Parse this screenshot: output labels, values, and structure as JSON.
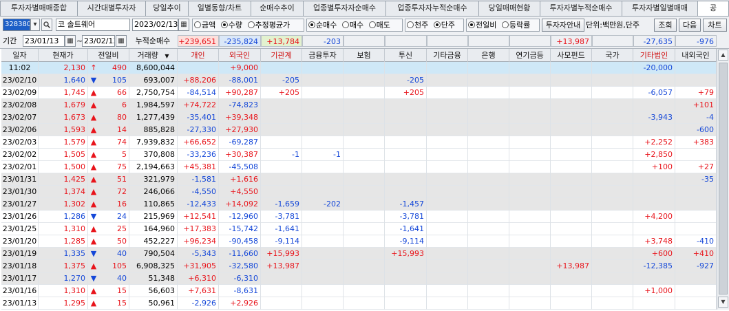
{
  "tabs": [
    {
      "label": "투자자별매매종합",
      "active": false
    },
    {
      "label": "시간대별투자자",
      "active": false
    },
    {
      "label": "당일추이",
      "active": false
    },
    {
      "label": "일별동향/차트",
      "active": false
    },
    {
      "label": "순매수추이",
      "active": false
    },
    {
      "label": "업종별투자자순매수",
      "active": false
    },
    {
      "label": "업종투자자누적순매수",
      "active": false
    },
    {
      "label": "당일매매현황",
      "active": false
    },
    {
      "label": "투자자별누적순매수",
      "active": false
    },
    {
      "label": "투자자별일별매매",
      "active": false
    },
    {
      "label": "공",
      "active": true
    }
  ],
  "toolbar": {
    "stock_code": "328380",
    "market_label": "코",
    "stock_name": "솔트웨어",
    "base_date": "2023/02/13",
    "radios1": [
      {
        "label": "금액",
        "on": false
      },
      {
        "label": "수량",
        "on": true
      },
      {
        "label": "추정평균가",
        "on": false
      }
    ],
    "radios2": [
      {
        "label": "순매수",
        "on": true
      },
      {
        "label": "매수",
        "on": false
      },
      {
        "label": "매도",
        "on": false
      }
    ],
    "radios3": [
      {
        "label": "천주",
        "on": false
      },
      {
        "label": "단주",
        "on": true
      }
    ],
    "radios4": [
      {
        "label": "전일비",
        "on": true
      },
      {
        "label": "등락률",
        "on": false
      }
    ],
    "guide_button": "투자자안내",
    "unit_text": "단위:백만원,단주",
    "search_button": "조회",
    "next_button": "다음",
    "chart_button": "차트"
  },
  "period": {
    "label": "기간",
    "start": "23/01/13",
    "tilde": "~",
    "end": "23/02/13",
    "cumulative_label": "누적순매수"
  },
  "summary": {
    "individual": "+239,651",
    "foreign": "-235,824",
    "institution": "+13,784",
    "financial": "-203",
    "insurance": "",
    "trust": "",
    "other_finance": "",
    "bank": "",
    "pension": "",
    "private_fund": "+13,987",
    "nation": "",
    "other_corp": "-27,635",
    "domestic_foreign": "-976"
  },
  "columns": [
    "일자",
    "현재가",
    "전일비",
    "거래량",
    "개인",
    "외국인",
    "기관계",
    "금융투자",
    "보험",
    "투신",
    "기타금융",
    "은행",
    "연기금등",
    "사모펀드",
    "국가",
    "기타법인",
    "내외국인"
  ],
  "sort_icon": "▼",
  "rows": [
    {
      "date": "11:02",
      "price": "2,130",
      "dir": "up-strong",
      "chg": "490",
      "vol": "8,600,044",
      "ind": "",
      "frn": "+9,000",
      "inst": "",
      "fin": "",
      "ins": "",
      "trust": "",
      "oth": "",
      "bank": "",
      "pen": "",
      "pf": "",
      "nat": "",
      "corp": "-20,000",
      "dom": ""
    },
    {
      "date": "23/02/10",
      "price": "1,640",
      "dir": "down",
      "chg": "105",
      "vol": "693,007",
      "ind": "+88,206",
      "frn": "-88,001",
      "inst": "-205",
      "fin": "",
      "ins": "",
      "trust": "-205",
      "oth": "",
      "bank": "",
      "pen": "",
      "pf": "",
      "nat": "",
      "corp": "",
      "dom": ""
    },
    {
      "date": "23/02/09",
      "price": "1,745",
      "dir": "up",
      "chg": "66",
      "vol": "2,750,754",
      "ind": "-84,514",
      "frn": "+90,287",
      "inst": "+205",
      "fin": "",
      "ins": "",
      "trust": "+205",
      "oth": "",
      "bank": "",
      "pen": "",
      "pf": "",
      "nat": "",
      "corp": "-6,057",
      "dom": "+79"
    },
    {
      "date": "23/02/08",
      "price": "1,679",
      "dir": "up",
      "chg": "6",
      "vol": "1,984,597",
      "ind": "+74,722",
      "frn": "-74,823",
      "inst": "",
      "fin": "",
      "ins": "",
      "trust": "",
      "oth": "",
      "bank": "",
      "pen": "",
      "pf": "",
      "nat": "",
      "corp": "",
      "dom": "+101"
    },
    {
      "date": "23/02/07",
      "price": "1,673",
      "dir": "up",
      "chg": "80",
      "vol": "1,277,439",
      "ind": "-35,401",
      "frn": "+39,348",
      "inst": "",
      "fin": "",
      "ins": "",
      "trust": "",
      "oth": "",
      "bank": "",
      "pen": "",
      "pf": "",
      "nat": "",
      "corp": "-3,943",
      "dom": "-4"
    },
    {
      "date": "23/02/06",
      "price": "1,593",
      "dir": "up",
      "chg": "14",
      "vol": "885,828",
      "ind": "-27,330",
      "frn": "+27,930",
      "inst": "",
      "fin": "",
      "ins": "",
      "trust": "",
      "oth": "",
      "bank": "",
      "pen": "",
      "pf": "",
      "nat": "",
      "corp": "",
      "dom": "-600"
    },
    {
      "date": "23/02/03",
      "price": "1,579",
      "dir": "up",
      "chg": "74",
      "vol": "7,939,832",
      "ind": "+66,652",
      "frn": "-69,287",
      "inst": "",
      "fin": "",
      "ins": "",
      "trust": "",
      "oth": "",
      "bank": "",
      "pen": "",
      "pf": "",
      "nat": "",
      "corp": "+2,252",
      "dom": "+383"
    },
    {
      "date": "23/02/02",
      "price": "1,505",
      "dir": "up",
      "chg": "5",
      "vol": "370,808",
      "ind": "-33,236",
      "frn": "+30,387",
      "inst": "-1",
      "fin": "-1",
      "ins": "",
      "trust": "",
      "oth": "",
      "bank": "",
      "pen": "",
      "pf": "",
      "nat": "",
      "corp": "+2,850",
      "dom": ""
    },
    {
      "date": "23/02/01",
      "price": "1,500",
      "dir": "up",
      "chg": "75",
      "vol": "2,194,663",
      "ind": "+45,381",
      "frn": "-45,508",
      "inst": "",
      "fin": "",
      "ins": "",
      "trust": "",
      "oth": "",
      "bank": "",
      "pen": "",
      "pf": "",
      "nat": "",
      "corp": "+100",
      "dom": "+27"
    },
    {
      "date": "23/01/31",
      "price": "1,425",
      "dir": "up",
      "chg": "51",
      "vol": "321,979",
      "ind": "-1,581",
      "frn": "+1,616",
      "inst": "",
      "fin": "",
      "ins": "",
      "trust": "",
      "oth": "",
      "bank": "",
      "pen": "",
      "pf": "",
      "nat": "",
      "corp": "",
      "dom": "-35"
    },
    {
      "date": "23/01/30",
      "price": "1,374",
      "dir": "up",
      "chg": "72",
      "vol": "246,066",
      "ind": "-4,550",
      "frn": "+4,550",
      "inst": "",
      "fin": "",
      "ins": "",
      "trust": "",
      "oth": "",
      "bank": "",
      "pen": "",
      "pf": "",
      "nat": "",
      "corp": "",
      "dom": ""
    },
    {
      "date": "23/01/27",
      "price": "1,302",
      "dir": "up",
      "chg": "16",
      "vol": "110,865",
      "ind": "-12,433",
      "frn": "+14,092",
      "inst": "-1,659",
      "fin": "-202",
      "ins": "",
      "trust": "-1,457",
      "oth": "",
      "bank": "",
      "pen": "",
      "pf": "",
      "nat": "",
      "corp": "",
      "dom": ""
    },
    {
      "date": "23/01/26",
      "price": "1,286",
      "dir": "down",
      "chg": "24",
      "vol": "215,969",
      "ind": "+12,541",
      "frn": "-12,960",
      "inst": "-3,781",
      "fin": "",
      "ins": "",
      "trust": "-3,781",
      "oth": "",
      "bank": "",
      "pen": "",
      "pf": "",
      "nat": "",
      "corp": "+4,200",
      "dom": ""
    },
    {
      "date": "23/01/25",
      "price": "1,310",
      "dir": "up",
      "chg": "25",
      "vol": "164,960",
      "ind": "+17,383",
      "frn": "-15,742",
      "inst": "-1,641",
      "fin": "",
      "ins": "",
      "trust": "-1,641",
      "oth": "",
      "bank": "",
      "pen": "",
      "pf": "",
      "nat": "",
      "corp": "",
      "dom": ""
    },
    {
      "date": "23/01/20",
      "price": "1,285",
      "dir": "up",
      "chg": "50",
      "vol": "452,227",
      "ind": "+96,234",
      "frn": "-90,458",
      "inst": "-9,114",
      "fin": "",
      "ins": "",
      "trust": "-9,114",
      "oth": "",
      "bank": "",
      "pen": "",
      "pf": "",
      "nat": "",
      "corp": "+3,748",
      "dom": "-410"
    },
    {
      "date": "23/01/19",
      "price": "1,335",
      "dir": "down",
      "chg": "40",
      "vol": "790,504",
      "ind": "-5,343",
      "frn": "-11,660",
      "inst": "+15,993",
      "fin": "",
      "ins": "",
      "trust": "+15,993",
      "oth": "",
      "bank": "",
      "pen": "",
      "pf": "",
      "nat": "",
      "corp": "+600",
      "dom": "+410"
    },
    {
      "date": "23/01/18",
      "price": "1,375",
      "dir": "up",
      "chg": "105",
      "vol": "6,908,325",
      "ind": "+31,905",
      "frn": "-32,580",
      "inst": "+13,987",
      "fin": "",
      "ins": "",
      "trust": "",
      "oth": "",
      "bank": "",
      "pen": "",
      "pf": "+13,987",
      "nat": "",
      "corp": "-12,385",
      "dom": "-927"
    },
    {
      "date": "23/01/17",
      "price": "1,270",
      "dir": "down",
      "chg": "40",
      "vol": "51,348",
      "ind": "+6,310",
      "frn": "-6,310",
      "inst": "",
      "fin": "",
      "ins": "",
      "trust": "",
      "oth": "",
      "bank": "",
      "pen": "",
      "pf": "",
      "nat": "",
      "corp": "",
      "dom": ""
    },
    {
      "date": "23/01/16",
      "price": "1,310",
      "dir": "up",
      "chg": "15",
      "vol": "56,603",
      "ind": "+7,631",
      "frn": "-8,631",
      "inst": "",
      "fin": "",
      "ins": "",
      "trust": "",
      "oth": "",
      "bank": "",
      "pen": "",
      "pf": "",
      "nat": "",
      "corp": "+1,000",
      "dom": ""
    },
    {
      "date": "23/01/13",
      "price": "1,295",
      "dir": "up",
      "chg": "15",
      "vol": "50,961",
      "ind": "-2,926",
      "frn": "+2,926",
      "inst": "",
      "fin": "",
      "ins": "",
      "trust": "",
      "oth": "",
      "bank": "",
      "pen": "",
      "pf": "",
      "nat": "",
      "corp": "",
      "dom": ""
    }
  ],
  "colors": {
    "up": "#e8141b",
    "down": "#1447d8",
    "current_row_bg": "#cfe8f7",
    "alt_row_bg": "#e6e6e6",
    "summary_individual_bg": "#fde0dc",
    "summary_foreign_bg": "#dbe8f8",
    "summary_institution_bg": "#e3f2cf"
  }
}
